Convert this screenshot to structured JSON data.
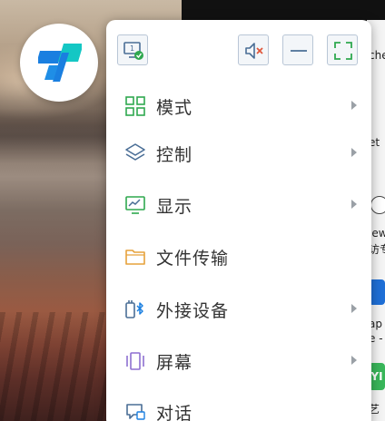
{
  "app_logo": {
    "icon": "app-logo-icon"
  },
  "toolbar": {
    "screen_icon_label": "1",
    "buttons": [
      {
        "name": "mute",
        "icon": "speaker-muted-icon"
      },
      {
        "name": "minimize",
        "icon": "minimize-icon"
      },
      {
        "name": "fullscreen",
        "icon": "fullscreen-icon"
      }
    ]
  },
  "menu": {
    "items": [
      {
        "label": "模式",
        "icon": "grid-icon",
        "has_submenu": true
      },
      {
        "label": "控制",
        "icon": "layers-icon",
        "has_submenu": true
      },
      {
        "label": "显示",
        "icon": "monitor-chart-icon",
        "has_submenu": true
      },
      {
        "label": "文件传输",
        "icon": "folder-icon",
        "has_submenu": false
      },
      {
        "label": "外接设备",
        "icon": "bluetooth-device-icon",
        "has_submenu": true
      },
      {
        "label": "屏幕",
        "icon": "screens-icon",
        "has_submenu": true
      },
      {
        "label": "对话",
        "icon": "chat-icon",
        "has_submenu": false
      }
    ]
  },
  "background": {
    "fragments": [
      "che",
      "et",
      "iew",
      "访专",
      "ap",
      "e -",
      "YI",
      "艺"
    ]
  },
  "colors": {
    "accent_blue": "#1a7fe0",
    "accent_teal": "#14c7c4",
    "green": "#2fa84f",
    "orange": "#e6a23c",
    "purple": "#8e6fd1",
    "mute_red": "#e0573b",
    "toolbar_blue": "#4a6e96"
  }
}
